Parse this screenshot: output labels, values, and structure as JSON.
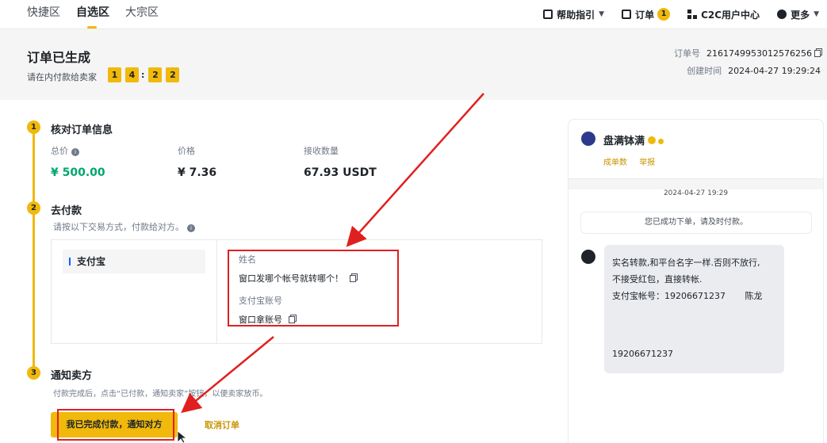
{
  "nav": {
    "tabs": [
      "快捷区",
      "自选区",
      "大宗区"
    ],
    "active_tab": 1,
    "help": "帮助指引",
    "orders": "订单",
    "orders_count": "1",
    "c2c": "C2C用户中心",
    "more": "更多"
  },
  "header": {
    "title": "订单已生成",
    "subtitle": "请在内付款给卖家",
    "timer": [
      "1",
      "4",
      ":",
      "2",
      "2"
    ],
    "order_no_label": "订单号",
    "order_no": "2161749953012576256",
    "created_label": "创建时间",
    "created": "2024-04-27 19:29:24"
  },
  "steps": {
    "s1": {
      "num": "1",
      "title": "核对订单信息"
    },
    "s2": {
      "num": "2",
      "title": "去付款",
      "desc": "请按以下交易方式，付款给对方。"
    },
    "s3": {
      "num": "3",
      "title": "通知卖方",
      "desc": "付款完成后，点击“已付款，通知卖家”按钮，以便卖家放币。"
    }
  },
  "summary": {
    "total_label": "总价",
    "total": "¥ 500.00",
    "price_label": "价格",
    "price": "¥ 7.36",
    "qty_label": "接收数量",
    "qty": "67.93 USDT"
  },
  "payment": {
    "method": "支付宝",
    "name_label": "姓名",
    "name_value": "窗口发哪个帐号就转哪个！",
    "account_label": "支付宝账号",
    "account_value": "窗口拿账号"
  },
  "actions": {
    "confirm": "我已完成付款，通知对方",
    "cancel": "取消订单"
  },
  "chat": {
    "seller": "盘满钵满",
    "links": [
      "成单数",
      "举报"
    ],
    "date": "2024-04-27 19:29",
    "system_msg": "您已成功下单，请及时付款。",
    "message_lines": [
      "实名转款,和平台名字一样.否则不放行,",
      "不接受红包，直接转帐.",
      "支付宝帐号：19206671237       陈龙"
    ],
    "message_tail": "19206671237"
  },
  "colors": {
    "accent": "#f0b90b",
    "annotation": "#e02020",
    "positive": "#03a66d"
  }
}
